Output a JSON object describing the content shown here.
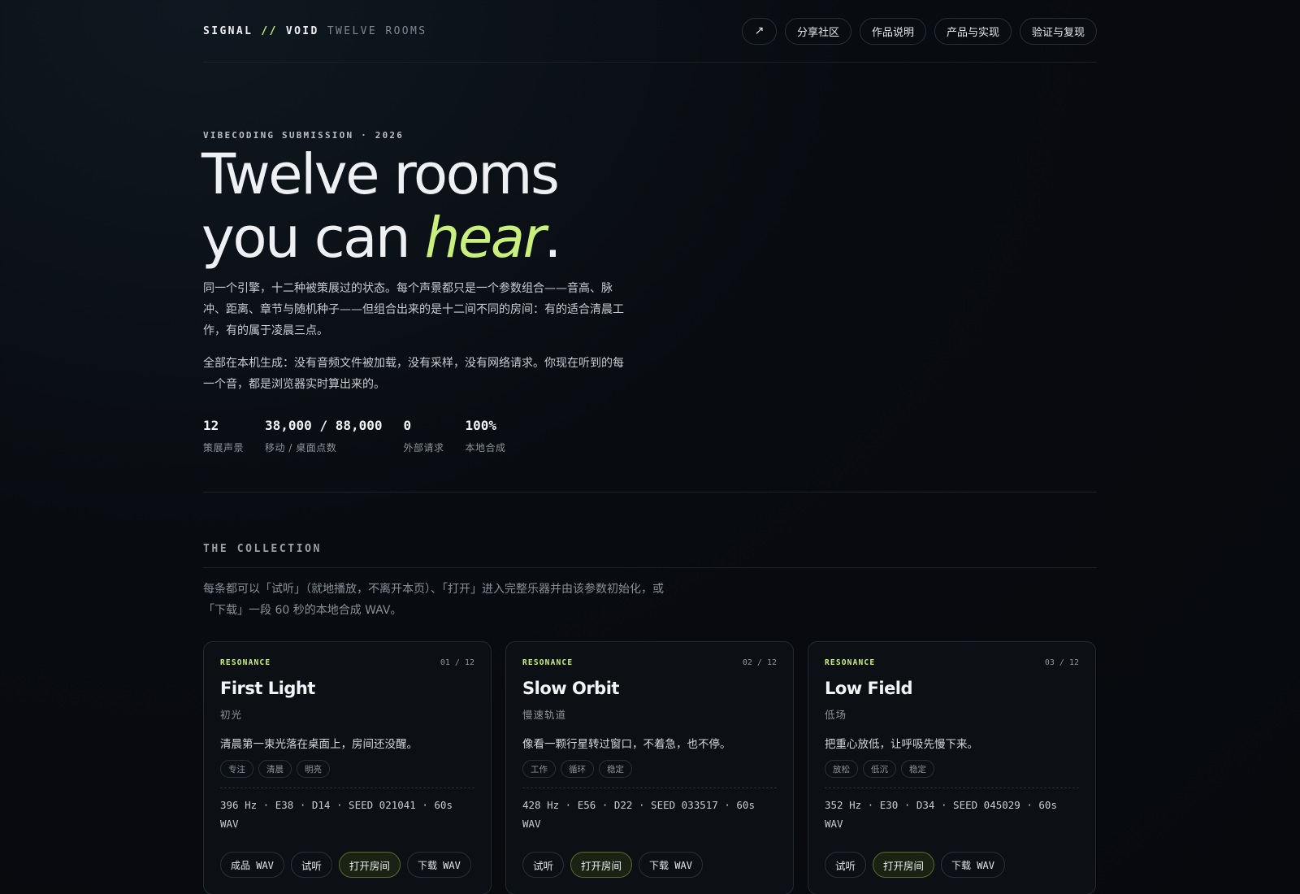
{
  "header": {
    "brand": {
      "signal": "SIGNAL",
      "sep": "//",
      "void": "VOID",
      "tag": "TWELVE ROOMS"
    },
    "nav": {
      "arrow_icon": "↗",
      "items": [
        "分享社区",
        "作品说明",
        "产品与实现",
        "验证与复现"
      ]
    }
  },
  "hero": {
    "eyebrow": "VIBECODING SUBMISSION · 2026",
    "title_line1": "Twelve rooms",
    "title_line2_pre": "you can ",
    "title_line2_accent": "hear",
    "title_line2_post": ".",
    "desc1": "同一个引擎，十二种被策展过的状态。每个声景都只是一个参数组合——音高、脉冲、距离、章节与随机种子——但组合出来的是十二间不同的房间：有的适合清晨工作，有的属于凌晨三点。",
    "desc2": "全部在本机生成：没有音频文件被加载，没有采样，没有网络请求。你现在听到的每一个音，都是浏览器实时算出来的。",
    "stats": [
      {
        "value": "12",
        "label": "策展声景"
      },
      {
        "value": "38,000 / 88,000",
        "label": "移动 / 桌面点数"
      },
      {
        "value": "0",
        "label": "外部请求"
      },
      {
        "value": "100%",
        "label": "本地合成"
      }
    ]
  },
  "collection": {
    "title": "THE COLLECTION",
    "desc": "每条都可以「试听」（就地播放，不离开本页）、「打开」进入完整乐器并由该参数初始化，或「下载」一段 60 秒的本地合成 WAV。",
    "cards": [
      {
        "kind": "RESONANCE",
        "index": "01 / 12",
        "title": "First Light",
        "subtitle": "初光",
        "line": "清晨第一束光落在桌面上，房间还没醒。",
        "tags": [
          "专注",
          "清晨",
          "明亮"
        ],
        "params": "396 Hz · E38 · D14 · SEED 021041 · 60s WAV",
        "actions": {
          "wav": "成品 WAV",
          "listen": "试听",
          "open": "打开房间",
          "download": "下载 WAV"
        }
      },
      {
        "kind": "RESONANCE",
        "index": "02 / 12",
        "title": "Slow Orbit",
        "subtitle": "慢速轨道",
        "line": "像看一颗行星转过窗口，不着急，也不停。",
        "tags": [
          "工作",
          "循环",
          "稳定"
        ],
        "params": "428 Hz · E56 · D22 · SEED 033517 · 60s WAV",
        "actions": {
          "listen": "试听",
          "open": "打开房间",
          "download": "下载 WAV"
        }
      },
      {
        "kind": "RESONANCE",
        "index": "03 / 12",
        "title": "Low Field",
        "subtitle": "低场",
        "line": "把重心放低，让呼吸先慢下来。",
        "tags": [
          "放松",
          "低沉",
          "稳定"
        ],
        "params": "352 Hz · E30 · D34 · SEED 045029 · 60s WAV",
        "actions": {
          "listen": "试听",
          "open": "打开房间",
          "download": "下载 WAV"
        }
      }
    ]
  }
}
